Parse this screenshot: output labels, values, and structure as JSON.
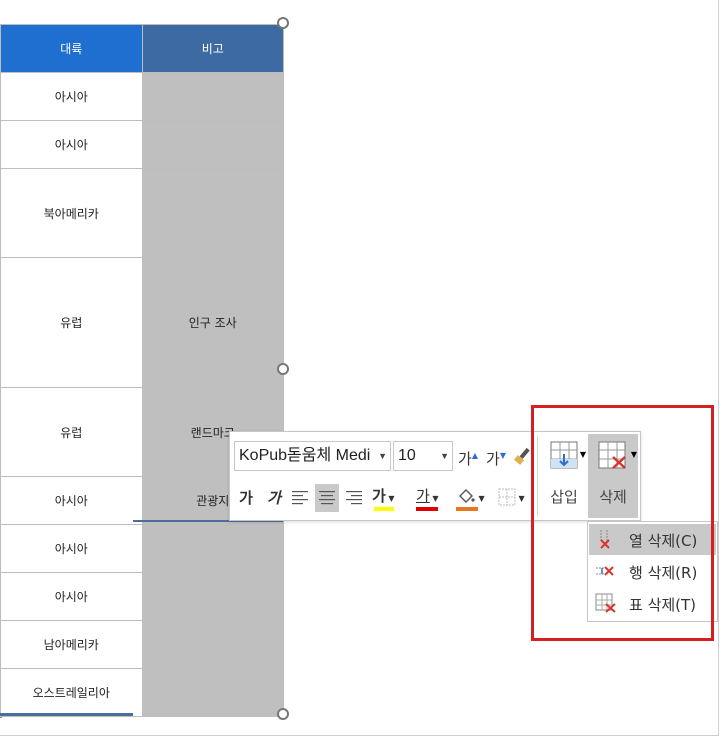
{
  "table": {
    "headers": [
      "대륙",
      "비고"
    ],
    "rows": [
      {
        "continent": "아시아",
        "note": ""
      },
      {
        "continent": "아시아",
        "note": ""
      },
      {
        "continent": "북아메리카",
        "note": ""
      },
      {
        "continent": "유럽",
        "note": "인구 조사"
      },
      {
        "continent": "유럽",
        "note": "랜드마크"
      },
      {
        "continent": "아시아",
        "note": "관광지"
      },
      {
        "continent": "아시아",
        "note": ""
      },
      {
        "continent": "아시아",
        "note": ""
      },
      {
        "continent": "남아메리카",
        "note": ""
      },
      {
        "continent": "오스트레일리아",
        "note": ""
      }
    ]
  },
  "toolbar": {
    "font_name": "KoPub돋움체 Medi",
    "font_size": "10",
    "grow_font_label": "가",
    "shrink_font_label": "가",
    "bold_label": "가",
    "italic_label": "가",
    "highlight_label": "가",
    "font_color_label": "가",
    "insert_label": "삽입",
    "delete_label": "삭제",
    "colors": {
      "highlight": "#ffff00",
      "font_color": "#e00000",
      "shading": "#e87722"
    }
  },
  "delete_menu": {
    "items": [
      {
        "label": "열 삭제(C)"
      },
      {
        "label": "행 삭제(R)"
      },
      {
        "label": "표 삭제(T)"
      }
    ]
  }
}
